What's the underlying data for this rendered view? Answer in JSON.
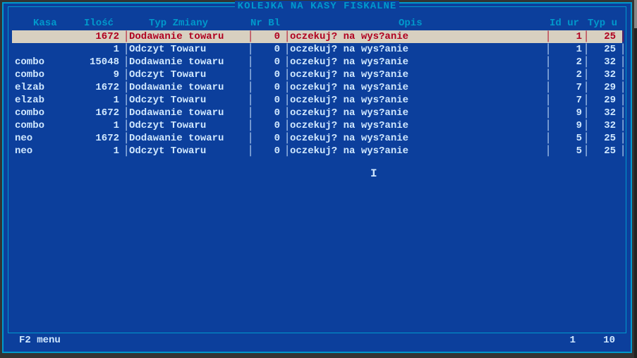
{
  "title": "KOLEJKA NA KASY FISKALNE",
  "columns": {
    "kasa": "Kasa",
    "ilosc": "Ilość",
    "typ": "Typ Zmiany",
    "nr": "Nr Bl",
    "opis": "Opis",
    "id": "Id ur",
    "typ_u": "Typ u"
  },
  "rows": [
    {
      "kasa": "",
      "ilosc": "1672",
      "typ": "Dodawanie towaru",
      "nr": "0",
      "opis": "oczekuj? na wys?anie",
      "id": "1",
      "typ_u": "25",
      "selected": true
    },
    {
      "kasa": "",
      "ilosc": "1",
      "typ": "Odczyt Towaru",
      "nr": "0",
      "opis": "oczekuj? na wys?anie",
      "id": "1",
      "typ_u": "25"
    },
    {
      "kasa": "combo",
      "ilosc": "15048",
      "typ": "Dodawanie towaru",
      "nr": "0",
      "opis": "oczekuj? na wys?anie",
      "id": "2",
      "typ_u": "32"
    },
    {
      "kasa": "combo",
      "ilosc": "9",
      "typ": "Odczyt Towaru",
      "nr": "0",
      "opis": "oczekuj? na wys?anie",
      "id": "2",
      "typ_u": "32"
    },
    {
      "kasa": "elzab",
      "ilosc": "1672",
      "typ": "Dodawanie towaru",
      "nr": "0",
      "opis": "oczekuj? na wys?anie",
      "id": "7",
      "typ_u": "29"
    },
    {
      "kasa": "elzab",
      "ilosc": "1",
      "typ": "Odczyt Towaru",
      "nr": "0",
      "opis": "oczekuj? na wys?anie",
      "id": "7",
      "typ_u": "29"
    },
    {
      "kasa": "combo",
      "ilosc": "1672",
      "typ": "Dodawanie towaru",
      "nr": "0",
      "opis": "oczekuj? na wys?anie",
      "id": "9",
      "typ_u": "32"
    },
    {
      "kasa": "combo",
      "ilosc": "1",
      "typ": "Odczyt Towaru",
      "nr": "0",
      "opis": "oczekuj? na wys?anie",
      "id": "9",
      "typ_u": "32"
    },
    {
      "kasa": "neo",
      "ilosc": "1672",
      "typ": "Dodawanie towaru",
      "nr": "0",
      "opis": "oczekuj? na wys?anie",
      "id": "5",
      "typ_u": "25"
    },
    {
      "kasa": "neo",
      "ilosc": "1",
      "typ": "Odczyt Towaru",
      "nr": "0",
      "opis": "oczekuj? na wys?anie",
      "id": "5",
      "typ_u": "25"
    }
  ],
  "footer": {
    "menu": "F2 menu",
    "pos": "1",
    "total": "10"
  }
}
